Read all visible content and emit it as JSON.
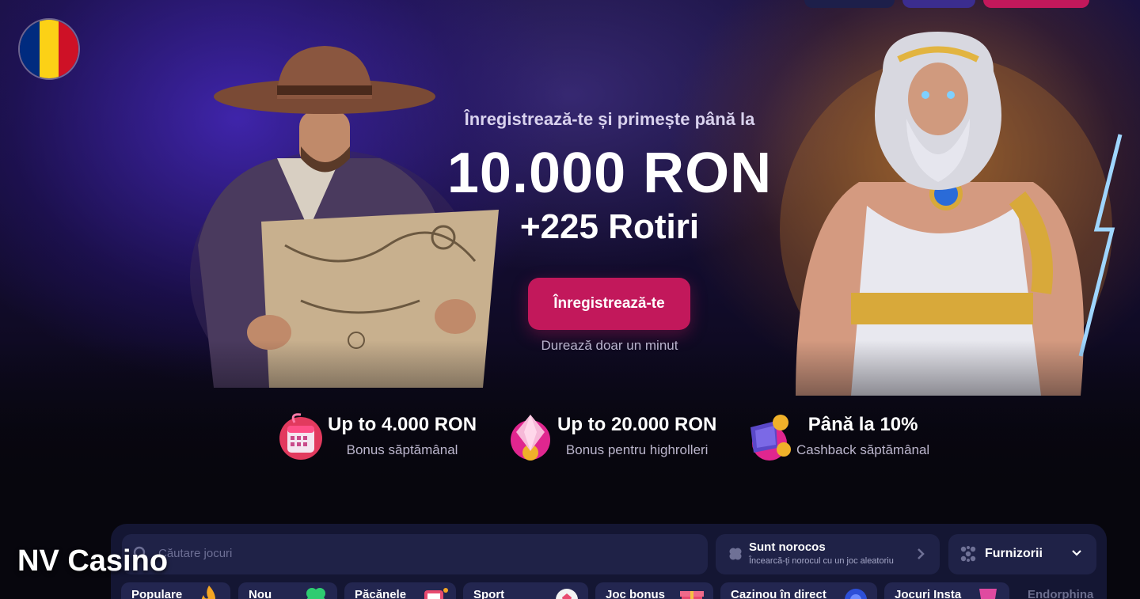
{
  "hero": {
    "headline": "Înregistrează-te și primește până la",
    "amount": "10.000 RON",
    "spins": "+225 Rotiri",
    "cta_label": "Înregistrează-te",
    "cta_sub": "Durează doar un minut"
  },
  "perks": [
    {
      "title": "Up to 4.000 RON",
      "subtitle": "Bonus săptămânal",
      "icon": "calendar-icon"
    },
    {
      "title": "Up to 20.000 RON",
      "subtitle": "Bonus pentru highrolleri",
      "icon": "gem-icon"
    },
    {
      "title": "Până la 10%",
      "subtitle": "Cashback săptămânal",
      "icon": "cashback-icon"
    }
  ],
  "search": {
    "placeholder": "Căutare jocuri"
  },
  "lucky": {
    "title": "Sunt norocos",
    "subtitle": "Încearcă-ți norocul cu un joc aleatoriu"
  },
  "providers": {
    "label": "Furnizorii"
  },
  "tabs": [
    {
      "label": "Populare",
      "icon": "fire-icon"
    },
    {
      "label": "Nou",
      "icon": "clover-icon"
    },
    {
      "label": "Păcănele",
      "icon": "slot-machine-icon"
    },
    {
      "label": "Sport",
      "icon": "soccer-ball-icon"
    },
    {
      "label": "Joc bonus",
      "icon": "gift-icon"
    },
    {
      "label": "Cazinou în direct",
      "icon": "chip-icon"
    },
    {
      "label": "Jocuri Insta",
      "icon": "cup-icon"
    },
    {
      "label": "Endorphina",
      "icon": ""
    }
  ],
  "watermark": "NV Casino",
  "colors": {
    "accent": "#c2185b",
    "panel": "#141633",
    "field": "#1f2247",
    "flag_blue": "#002b7f",
    "flag_yellow": "#fcd116",
    "flag_red": "#ce1126"
  }
}
